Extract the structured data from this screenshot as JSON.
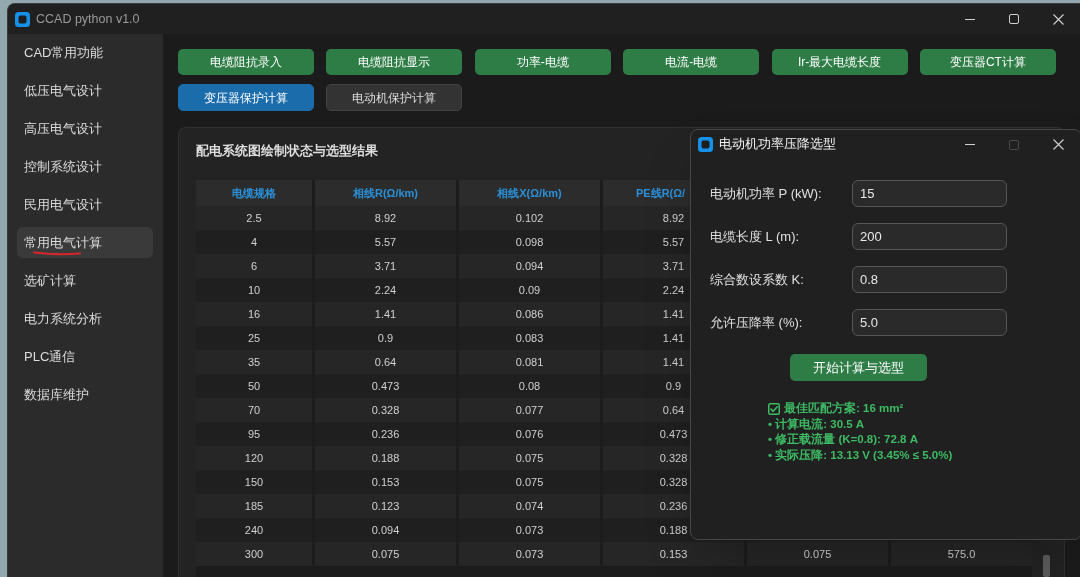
{
  "window": {
    "title": "CCAD python v1.0",
    "active": false
  },
  "sidebar": {
    "items": [
      {
        "label": "CAD常用功能",
        "selected": false,
        "underlined": false
      },
      {
        "label": "低压电气设计",
        "selected": false,
        "underlined": false
      },
      {
        "label": "高压电气设计",
        "selected": false,
        "underlined": false
      },
      {
        "label": "控制系统设计",
        "selected": false,
        "underlined": false
      },
      {
        "label": "民用电气设计",
        "selected": false,
        "underlined": false
      },
      {
        "label": "常用电气计算",
        "selected": true,
        "underlined": true
      },
      {
        "label": "选矿计算",
        "selected": false,
        "underlined": false
      },
      {
        "label": "电力系统分析",
        "selected": false,
        "underlined": false
      },
      {
        "label": "PLC通信",
        "selected": false,
        "underlined": false
      },
      {
        "label": "数据库维护",
        "selected": false,
        "underlined": false
      }
    ]
  },
  "action_buttons": [
    "电缆阻抗录入",
    "电缆阻抗显示",
    "功率-电缆",
    "电流-电缆",
    "Ir-最大电缆长度",
    "变压器CT计算"
  ],
  "tabs": [
    {
      "label": "变压器保护计算",
      "selected": true
    },
    {
      "label": "电动机保护计算",
      "selected": false
    }
  ],
  "panel": {
    "title": "配电系统图绘制状态与选型结果",
    "table": {
      "columns": [
        "电缆规格",
        "相线R(Ω/km)",
        "相线X(Ω/km)",
        "PE线R(Ω/"
      ],
      "rows": [
        [
          "2.5",
          "8.92",
          "0.102",
          "8.92"
        ],
        [
          "4",
          "5.57",
          "0.098",
          "5.57"
        ],
        [
          "6",
          "3.71",
          "0.094",
          "3.71"
        ],
        [
          "10",
          "2.24",
          "0.09",
          "2.24"
        ],
        [
          "16",
          "1.41",
          "0.086",
          "1.41"
        ],
        [
          "25",
          "0.9",
          "0.083",
          "1.41"
        ],
        [
          "35",
          "0.64",
          "0.081",
          "1.41"
        ],
        [
          "50",
          "0.473",
          "0.08",
          "0.9"
        ],
        [
          "70",
          "0.328",
          "0.077",
          "0.64"
        ],
        [
          "95",
          "0.236",
          "0.076",
          "0.473"
        ],
        [
          "120",
          "0.188",
          "0.075",
          "0.328"
        ],
        [
          "150",
          "0.153",
          "0.075",
          "0.328"
        ],
        [
          "185",
          "0.123",
          "0.074",
          "0.236"
        ],
        [
          "240",
          "0.094",
          "0.073",
          "0.188"
        ],
        [
          "300",
          "0.075",
          "0.073",
          "0.153",
          "0.075",
          "575.0"
        ]
      ]
    }
  },
  "dialog": {
    "title": "电动机功率压降选型",
    "active": true,
    "maximize_disabled": true,
    "fields": [
      {
        "label": "电动机功率 P (kW):",
        "value": "15"
      },
      {
        "label": "电缆长度 L (m):",
        "value": "200"
      },
      {
        "label": "综合数设系数 K:",
        "value": "0.8"
      },
      {
        "label": "允许压降率 (%):",
        "value": "5.0"
      }
    ],
    "button": "开始计算与选型",
    "results": [
      {
        "kind": "heading",
        "text": "最佳匹配方案: 16 mm²"
      },
      {
        "kind": "item",
        "text": "• 计算电流: 30.5 A"
      },
      {
        "kind": "item",
        "text": "• 修正载流量 (K=0.8): 72.8 A"
      },
      {
        "kind": "item",
        "text": "• 实际压降: 13.13 V (3.45% ≤ 5.0%)"
      }
    ]
  }
}
